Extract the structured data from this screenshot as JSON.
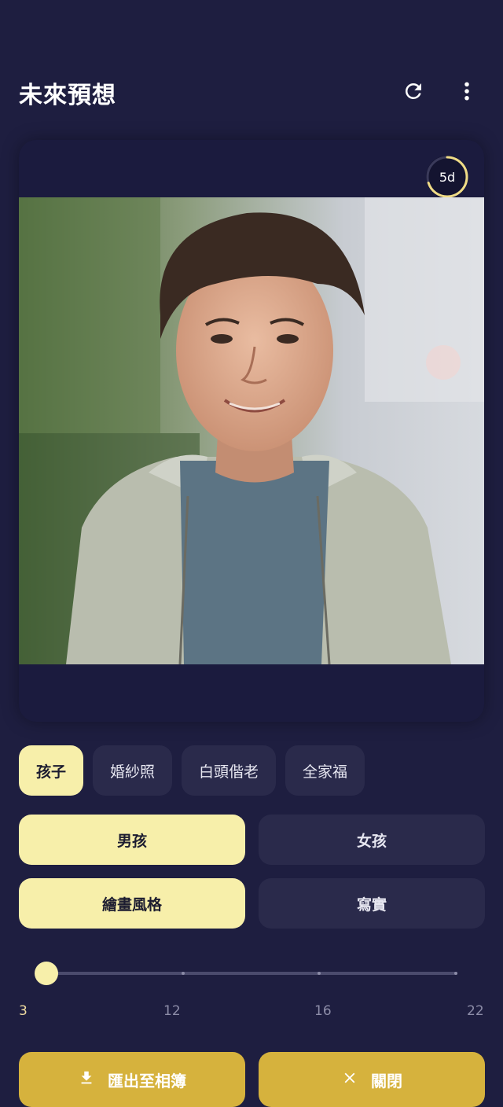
{
  "header": {
    "title": "未來預想",
    "refresh_icon": "refresh-icon",
    "more_icon": "more-vert-icon"
  },
  "preview": {
    "badge_text": "5d",
    "badge_progress": 0.7,
    "image_subject": "smiling teenage boy in grey t-shirt and light green jacket, blurred park background"
  },
  "categories": [
    {
      "label": "孩子",
      "active": true
    },
    {
      "label": "婚紗照",
      "active": false
    },
    {
      "label": "白頭偕老",
      "active": false
    },
    {
      "label": "全家福",
      "active": false
    }
  ],
  "gender": {
    "boy": "男孩",
    "girl": "女孩",
    "selected": "男孩"
  },
  "style": {
    "paint": "繪畫風格",
    "real": "寫實",
    "selected": "繪畫風格"
  },
  "age_slider": {
    "labels": [
      "3",
      "12",
      "16",
      "22"
    ],
    "value": "3"
  },
  "actions": {
    "export_label": "匯出至相簿",
    "export_icon": "download-icon",
    "close_label": "關閉",
    "close_icon": "close-icon"
  },
  "colors": {
    "background": "#1e1e40",
    "accent": "#f7efaa",
    "button": "#d6b23d"
  }
}
